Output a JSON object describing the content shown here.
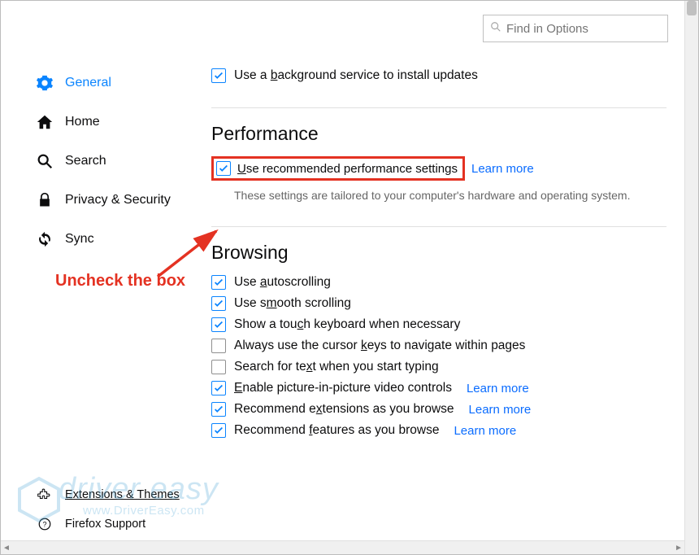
{
  "search": {
    "placeholder": "Find in Options"
  },
  "sidebar": {
    "items": [
      {
        "label": "General"
      },
      {
        "label": "Home"
      },
      {
        "label": "Search"
      },
      {
        "label": "Privacy & Security"
      },
      {
        "label": "Sync"
      }
    ],
    "footer": [
      {
        "label": "Extensions & Themes"
      },
      {
        "label": "Firefox Support"
      }
    ]
  },
  "updates": {
    "background_service": {
      "pre": "Use a ",
      "u": "b",
      "post": "ackground service to install updates"
    }
  },
  "performance": {
    "heading": "Performance",
    "use_recommended": {
      "u": "U",
      "post": "se recommended performance settings"
    },
    "learn_more": "Learn more",
    "note": "These settings are tailored to your computer's hardware and operating system."
  },
  "browsing": {
    "heading": "Browsing",
    "items": [
      {
        "checked": true,
        "pre": "Use ",
        "u": "a",
        "post": "utoscrolling",
        "link": ""
      },
      {
        "checked": true,
        "pre": "Use s",
        "u": "m",
        "post": "ooth scrolling",
        "link": ""
      },
      {
        "checked": true,
        "pre": "Show a tou",
        "u": "c",
        "post": "h keyboard when necessary",
        "link": ""
      },
      {
        "checked": false,
        "pre": "Always use the cursor ",
        "u": "k",
        "post": "eys to navigate within pages",
        "link": ""
      },
      {
        "checked": false,
        "pre": "Search for te",
        "u": "x",
        "post": "t when you start typing",
        "link": ""
      },
      {
        "checked": true,
        "pre": "",
        "u": "E",
        "post": "nable picture-in-picture video controls",
        "link": "Learn more"
      },
      {
        "checked": true,
        "pre": "Recommend e",
        "u": "x",
        "post": "tensions as you browse",
        "link": "Learn more"
      },
      {
        "checked": true,
        "pre": "Recommend ",
        "u": "f",
        "post": "eatures as you browse",
        "link": "Learn more"
      }
    ]
  },
  "annotation": {
    "text": "Uncheck the box"
  },
  "watermark": {
    "line1": "driver easy",
    "line2": "www.DriverEasy.com"
  }
}
